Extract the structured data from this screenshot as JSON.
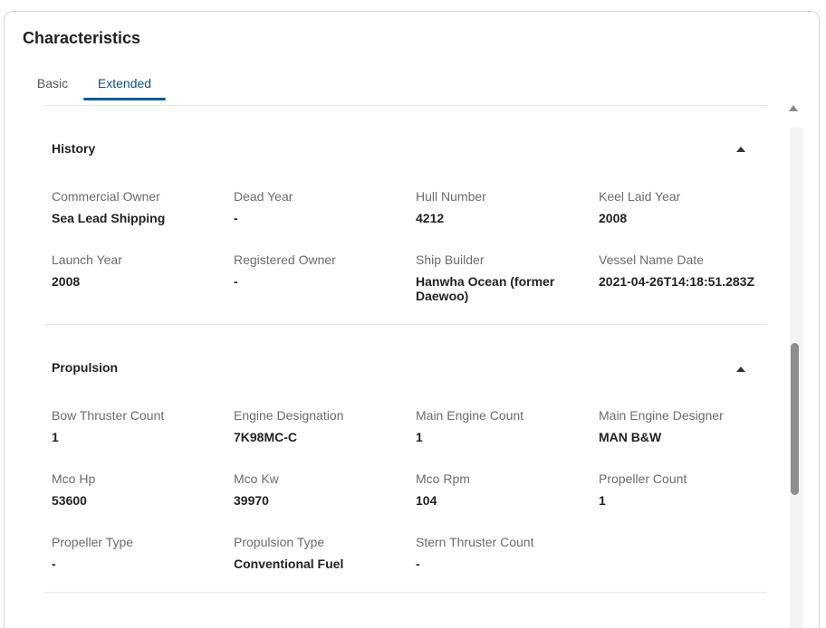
{
  "card": {
    "title": "Characteristics"
  },
  "tabs": [
    {
      "label": "Basic",
      "active": false
    },
    {
      "label": "Extended",
      "active": true
    }
  ],
  "sections": {
    "history": {
      "title": "History",
      "fields": [
        {
          "label": "Commercial Owner",
          "value": "Sea Lead Shipping"
        },
        {
          "label": "Dead Year",
          "value": "-"
        },
        {
          "label": "Hull Number",
          "value": "4212"
        },
        {
          "label": "Keel Laid Year",
          "value": "2008"
        },
        {
          "label": "Launch Year",
          "value": "2008"
        },
        {
          "label": "Registered Owner",
          "value": "-"
        },
        {
          "label": "Ship Builder",
          "value": "Hanwha Ocean (former Daewoo)"
        },
        {
          "label": "Vessel Name Date",
          "value": "2021-04-26T14:18:51.283Z"
        }
      ]
    },
    "propulsion": {
      "title": "Propulsion",
      "fields": [
        {
          "label": "Bow Thruster Count",
          "value": "1"
        },
        {
          "label": "Engine Designation",
          "value": "7K98MC-C"
        },
        {
          "label": "Main Engine Count",
          "value": "1"
        },
        {
          "label": "Main Engine Designer",
          "value": "MAN B&W"
        },
        {
          "label": "Mco Hp",
          "value": "53600"
        },
        {
          "label": "Mco Kw",
          "value": "39970"
        },
        {
          "label": "Mco Rpm",
          "value": "104"
        },
        {
          "label": "Propeller Count",
          "value": "1"
        },
        {
          "label": "Propeller Type",
          "value": "-"
        },
        {
          "label": "Propulsion Type",
          "value": "Conventional Fuel"
        },
        {
          "label": "Stern Thruster Count",
          "value": "-"
        }
      ]
    }
  },
  "icons": {
    "collapse": "chevron-up-icon",
    "scroll_up": "scroll-up-arrow-icon"
  },
  "colors": {
    "accent": "#0f5b96",
    "active_tab_text": "#0f4f82",
    "label_text": "#6b6b6b",
    "value_text": "#222222"
  }
}
